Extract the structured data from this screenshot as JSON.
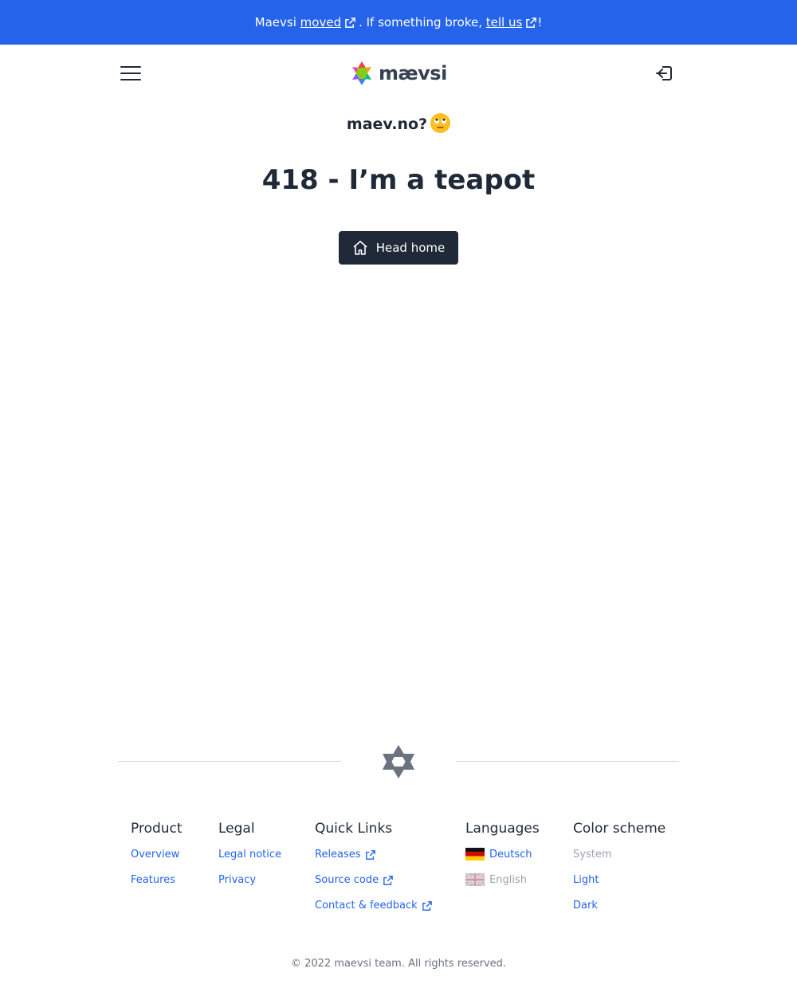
{
  "banner": {
    "prefix": "Maevsi",
    "moved_link": "moved",
    "middle": ". If something broke,",
    "tell_us_link": "tell us",
    "suffix": "!"
  },
  "header": {
    "menu_icon": "hamburger-menu-icon",
    "logo_text": "mævsi",
    "login_icon": "sign-in-icon"
  },
  "main": {
    "subtitle": "maev.no?",
    "subtitle_emoji": "eye-roll-emoji",
    "title": "418 - I’m a teapot",
    "home_button": "Head home",
    "home_icon": "house-icon"
  },
  "footer": {
    "columns": [
      {
        "heading": "Product",
        "items": [
          "Overview",
          "Features"
        ]
      },
      {
        "heading": "Legal",
        "items": [
          "Legal notice",
          "Privacy"
        ]
      },
      {
        "heading": "Quick Links",
        "items": [
          "Releases",
          "Source code",
          "Contact & feedback"
        ]
      },
      {
        "heading": "Languages",
        "items": [
          "Deutsch",
          "English"
        ]
      },
      {
        "heading": "Color scheme",
        "items": [
          "System",
          "Light",
          "Dark"
        ]
      }
    ],
    "copyright": "© 2022 maevsi team. All rights reserved."
  },
  "colors": {
    "banner": "#2563eb",
    "link": "#2563eb",
    "button_bg": "#1f2937",
    "muted": "#9ca3af"
  }
}
